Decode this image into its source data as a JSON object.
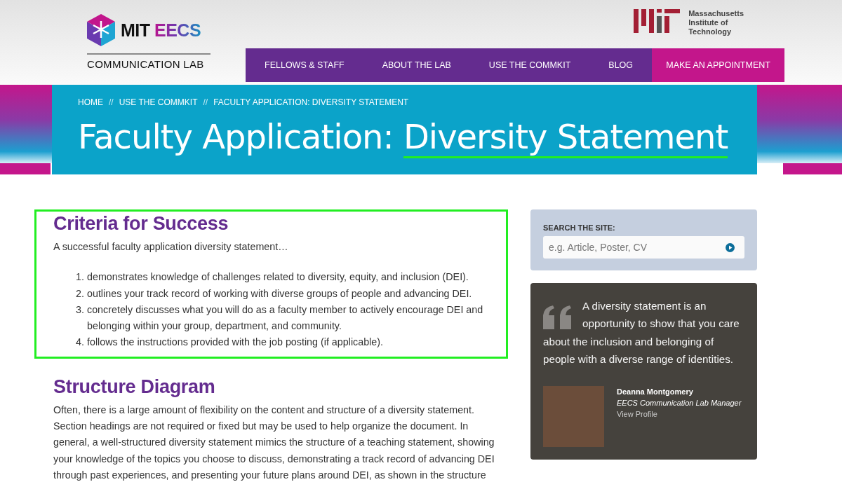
{
  "header": {
    "logo": {
      "name": "MIT",
      "accent": "EECS",
      "subtitle": "COMMUNICATION LAB"
    },
    "institute": {
      "lines": [
        "Massachusetts",
        "Institute of",
        "Technology"
      ]
    }
  },
  "nav": [
    {
      "label": "FELLOWS & STAFF",
      "kind": "link"
    },
    {
      "label": "ABOUT THE LAB",
      "kind": "link"
    },
    {
      "label": "USE THE COMMKIT",
      "kind": "link"
    },
    {
      "label": "BLOG",
      "kind": "link"
    },
    {
      "label": "MAKE AN APPOINTMENT",
      "kind": "cta"
    }
  ],
  "breadcrumbs": [
    "HOME",
    "USE THE COMMKIT",
    "FACULTY APPLICATION: DIVERSITY STATEMENT"
  ],
  "breadcrumb_separator": "//",
  "title": [
    {
      "text": "Faculty Application: ",
      "underlined": false
    },
    {
      "text": "Diversity Statement",
      "underlined": true
    }
  ],
  "sections": [
    {
      "heading": "Criteria for Success",
      "highlighted": true,
      "intro": "A successful faculty application diversity statement…",
      "items": [
        {
          "marker": "1.",
          "text": "demonstrates knowledge of challenges related to diversity, equity, and inclusion (DEI)."
        },
        {
          "marker": "2.",
          "text": "outlines your track record of working with diverse groups of people and advancing DEI."
        },
        {
          "marker": "3.",
          "text": "concretely discusses what you will do as a faculty member to actively encourage DEI and belonging within your group, department, and community."
        },
        {
          "marker": "4.",
          "text": "follows the instructions provided with the job posting (if applicable)."
        }
      ]
    },
    {
      "heading": "Structure Diagram",
      "highlighted": false,
      "intro": "Often, there is a large amount of flexibility on the content and structure of a diversity statement. Section headings are not required or fixed but may be used to help organize the document. In general, a well-structured diversity statement mimics the structure of a teaching statement, showing your knowledge of the topics you choose to discuss, demonstrating a track record of advancing DEI through past experiences, and presenting your future plans around DEI, as shown in the structure"
    }
  ],
  "search": {
    "label": "SEARCH THE SITE:",
    "placeholder": "e.g. Article, Poster, CV"
  },
  "quote": {
    "text": "A diversity statement is an opportunity to show that you care about the inclusion and belonging of people with a diverse range of identities.",
    "name": "Deanna Montgomery",
    "role": "EECS Communication Lab Manager",
    "link": "View Profile"
  }
}
